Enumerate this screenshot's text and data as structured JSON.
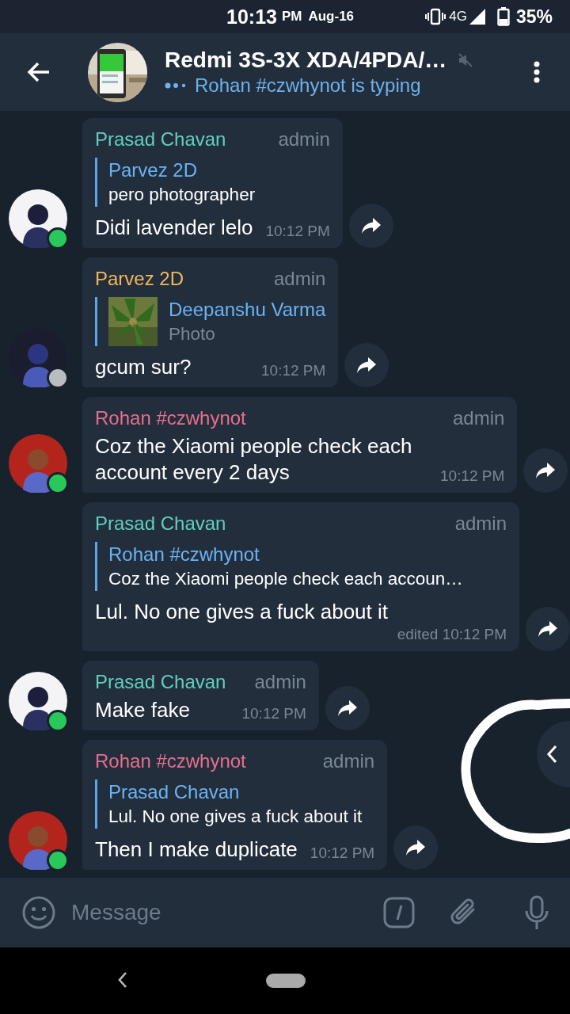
{
  "status_bar": {
    "time": "10:13",
    "ampm": "PM",
    "date": "Aug-16",
    "network": "4G",
    "battery": "35%"
  },
  "header": {
    "title": "Redmi 3S-3X XDA/4PDA/…",
    "muted": true,
    "subtitle": "Rohan #czwhynot is typing"
  },
  "messages": [
    {
      "sender": "Prasad Chavan",
      "color": "#5fcfc0",
      "role": "admin",
      "avatar": {
        "kind": "anime"
      },
      "online": true,
      "reply": {
        "name": "Parvez 2D",
        "text": "pero photographer"
      },
      "text": "Didi lavender lelo",
      "time": "10:12 PM"
    },
    {
      "sender": "Parvez 2D",
      "color": "#f1b85b",
      "role": "admin",
      "avatar": {
        "kind": "anime-dark"
      },
      "online": false,
      "reply": {
        "name": "Deepanshu Varma",
        "text": "Photo"
      },
      "text": "gcum sur?",
      "time": "10:12 PM"
    },
    {
      "sender": "Rohan #czwhynot",
      "color": "#e76f8e",
      "role": "admin",
      "avatar": {
        "kind": "person"
      },
      "online": true,
      "text": "Coz the Xiaomi people check each account every 2 days",
      "time": "10:12 PM"
    },
    {
      "sender": "Prasad Chavan",
      "color": "#5fcfc0",
      "role": "admin",
      "reply": {
        "name": "Rohan #czwhynot",
        "text": "Coz the Xiaomi people check each accoun…"
      },
      "text": "Lul. No one gives a fuck about it",
      "time": "edited 10:12 PM"
    },
    {
      "sender": "Prasad Chavan",
      "color": "#5fcfc0",
      "role": "admin",
      "avatar": {
        "kind": "anime"
      },
      "online": true,
      "text": "Make fake",
      "time": "10:12 PM"
    },
    {
      "sender": "Rohan #czwhynot",
      "color": "#e76f8e",
      "role": "admin",
      "avatar": {
        "kind": "person"
      },
      "online": true,
      "reply": {
        "name": "Prasad Chavan",
        "text": "Lul. No one gives a fuck about it"
      },
      "text": "Then I make duplicate",
      "time": "10:12 PM"
    }
  ],
  "input": {
    "placeholder": "Message"
  }
}
